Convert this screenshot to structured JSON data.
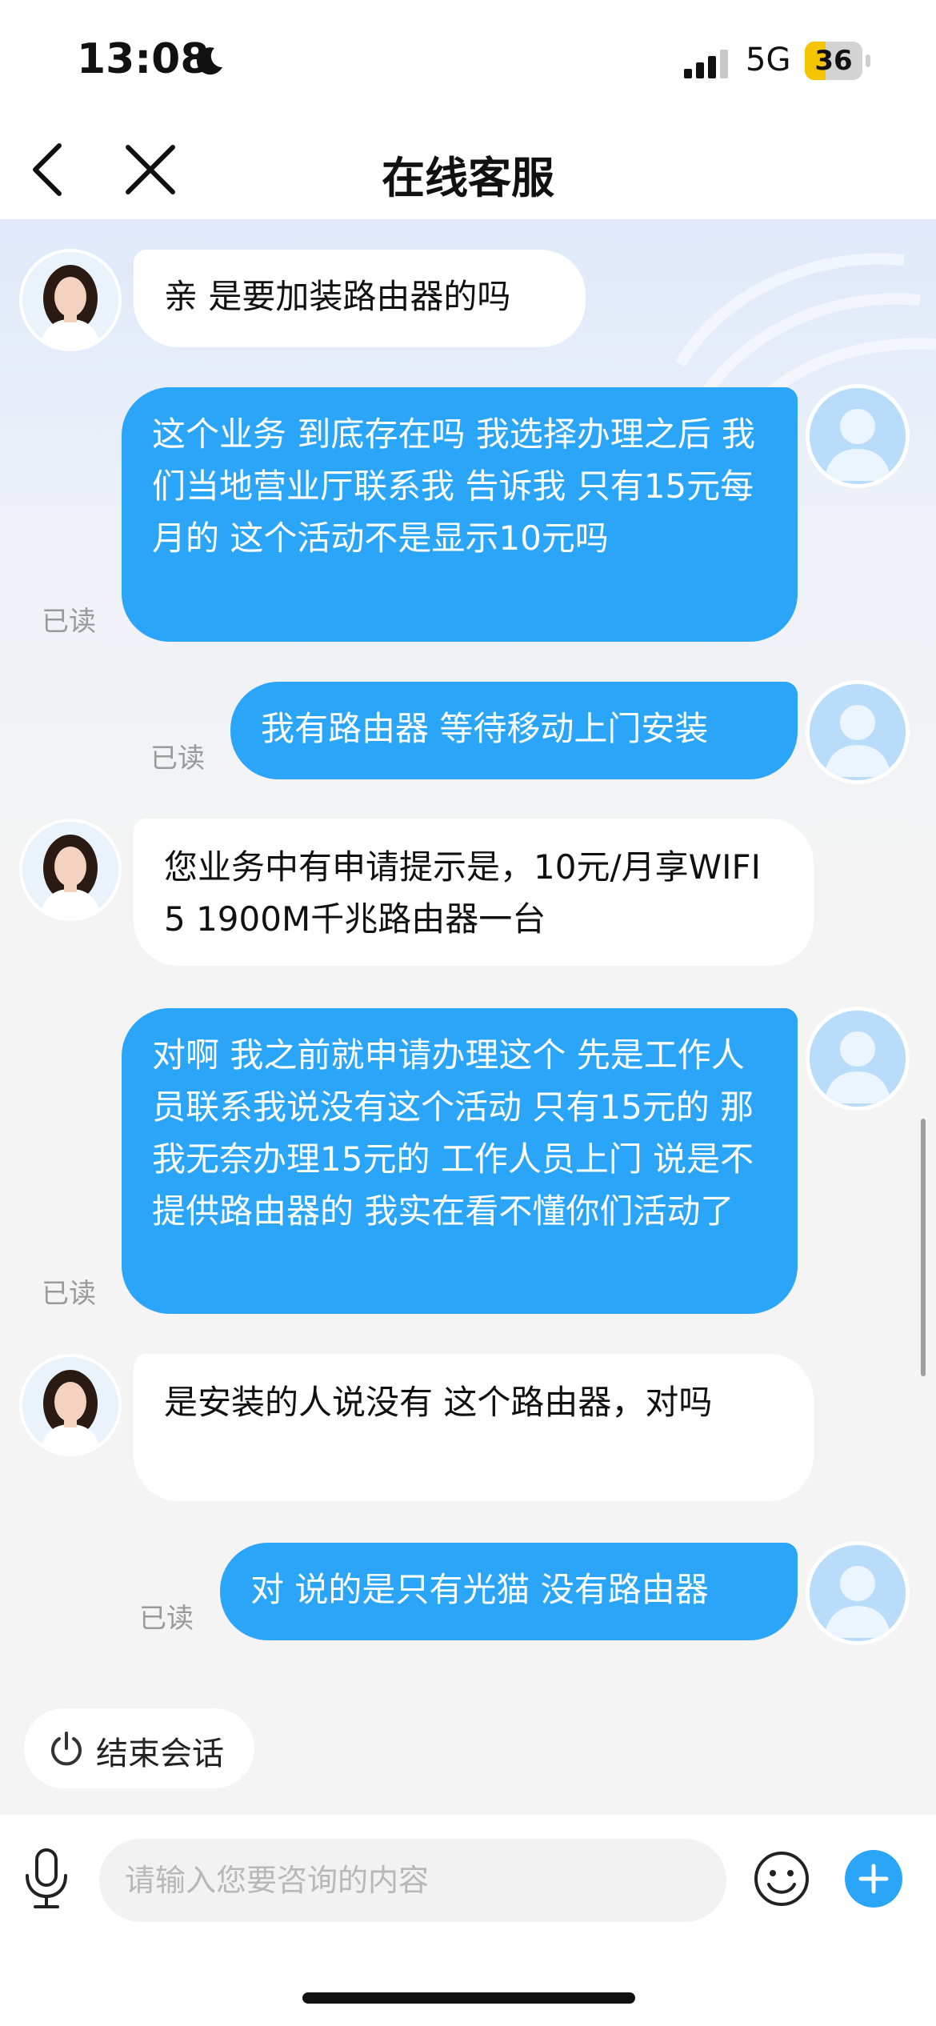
{
  "status_bar": {
    "time": "13:08",
    "network": "5G",
    "battery": "36",
    "battery_level": 0.36
  },
  "nav": {
    "title": "在线客服"
  },
  "messages": [
    {
      "from": "bot",
      "text": "亲 是要加装路由器的吗"
    },
    {
      "from": "user",
      "text": "这个业务 到底存在吗 我选择办理之后 我们当地营业厅联系我 告诉我 只有15元每月的 这个活动不是显示10元吗",
      "status": "已读"
    },
    {
      "from": "user",
      "text": "我有路由器 等待移动上门安装",
      "status": "已读"
    },
    {
      "from": "bot",
      "text": "您业务中有申请提示是，10元/月享WIFI5 1900M千兆路由器一台"
    },
    {
      "from": "user",
      "text": "对啊 我之前就申请办理这个 先是工作人员联系我说没有这个活动 只有15元的 那我无奈办理15元的 工作人员上门 说是不提供路由器的 我实在看不懂你们活动了",
      "status": "已读"
    },
    {
      "from": "bot",
      "text": "是安装的人说没有 这个路由器，对吗"
    },
    {
      "from": "user",
      "text": "对 说的是只有光猫 没有路由器",
      "status": "已读"
    }
  ],
  "end_session": {
    "label": "结束会话"
  },
  "input": {
    "placeholder": "请输入您要咨询的内容",
    "value": ""
  },
  "colors": {
    "accent": "#2ba5f7",
    "chat_bg": "#f4f4f4"
  },
  "icons": [
    "back-icon",
    "close-icon",
    "power-icon",
    "microphone-icon",
    "emoji-icon",
    "plus-icon"
  ]
}
